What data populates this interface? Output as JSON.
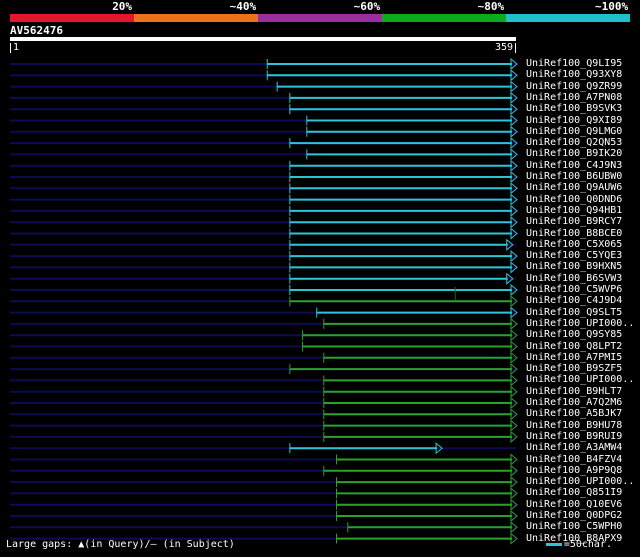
{
  "header": {
    "percent_labels": [
      "20%",
      "~40%",
      "~60%",
      "~80%",
      "~100%"
    ],
    "percent_colors": [
      "#e8132d",
      "#e8731c",
      "#9b2e9c",
      "#0eaa1a",
      "#1fc0c6"
    ]
  },
  "query": {
    "name": "AV562476",
    "start": "1",
    "end": "359"
  },
  "colors": {
    "backbone": "#0c0c55",
    "cyan": "#2bc6d6",
    "green": "#2aa12a",
    "marker": "#0a6a0a"
  },
  "hits": [
    {
      "name": "UniRef100_Q9LI95",
      "start": 183,
      "end": 359,
      "color": "cyan"
    },
    {
      "name": "UniRef100_Q93XY8",
      "start": 183,
      "end": 359,
      "color": "cyan"
    },
    {
      "name": "UniRef100_Q9ZR99",
      "start": 190,
      "end": 359,
      "color": "cyan"
    },
    {
      "name": "UniRef100_A7PN08",
      "start": 199,
      "end": 359,
      "color": "cyan"
    },
    {
      "name": "UniRef100_B9SVK3",
      "start": 199,
      "end": 359,
      "color": "cyan"
    },
    {
      "name": "UniRef100_Q9XI89",
      "start": 211,
      "end": 359,
      "color": "cyan"
    },
    {
      "name": "UniRef100_Q9LMG0",
      "start": 211,
      "end": 359,
      "color": "cyan"
    },
    {
      "name": "UniRef100_Q2QN53",
      "start": 199,
      "end": 359,
      "color": "cyan"
    },
    {
      "name": "UniRef100_B9IK20",
      "start": 211,
      "end": 359,
      "color": "cyan"
    },
    {
      "name": "UniRef100_C4J9N3",
      "start": 199,
      "end": 359,
      "color": "cyan"
    },
    {
      "name": "UniRef100_B6UBW0",
      "start": 199,
      "end": 359,
      "color": "cyan"
    },
    {
      "name": "UniRef100_Q9AUW6",
      "start": 199,
      "end": 359,
      "color": "cyan"
    },
    {
      "name": "UniRef100_Q0DND6",
      "start": 199,
      "end": 359,
      "color": "cyan"
    },
    {
      "name": "UniRef100_Q94HB1",
      "start": 199,
      "end": 359,
      "color": "cyan"
    },
    {
      "name": "UniRef100_B9RCY7",
      "start": 199,
      "end": 359,
      "color": "cyan"
    },
    {
      "name": "UniRef100_B8BCE0",
      "start": 199,
      "end": 359,
      "color": "cyan"
    },
    {
      "name": "UniRef100_C5X065",
      "start": 199,
      "end": 356,
      "color": "cyan"
    },
    {
      "name": "UniRef100_C5YQE3",
      "start": 199,
      "end": 359,
      "color": "cyan"
    },
    {
      "name": "UniRef100_B9HXN5",
      "start": 199,
      "end": 359,
      "color": "cyan"
    },
    {
      "name": "UniRef100_B6SVW3",
      "start": 199,
      "end": 356,
      "color": "cyan"
    },
    {
      "name": "UniRef100_C5WVP6",
      "start": 199,
      "end": 359,
      "color": "cyan",
      "marker": 316
    },
    {
      "name": "UniRef100_C4J9D4",
      "start": 199,
      "end": 359,
      "color": "green"
    },
    {
      "name": "UniRef100_Q9SLT5",
      "start": 218,
      "end": 359,
      "color": "cyan"
    },
    {
      "name": "UniRef100_UPI000..",
      "start": 223,
      "end": 359,
      "color": "green"
    },
    {
      "name": "UniRef100_Q9SY85",
      "start": 208,
      "end": 359,
      "color": "green"
    },
    {
      "name": "UniRef100_Q8LPT2",
      "start": 208,
      "end": 359,
      "color": "green"
    },
    {
      "name": "UniRef100_A7PMI5",
      "start": 223,
      "end": 359,
      "color": "green"
    },
    {
      "name": "UniRef100_B9SZF5",
      "start": 199,
      "end": 359,
      "color": "green"
    },
    {
      "name": "UniRef100_UPI000..",
      "start": 223,
      "end": 359,
      "color": "green"
    },
    {
      "name": "UniRef100_B9HLT7",
      "start": 223,
      "end": 359,
      "color": "green"
    },
    {
      "name": "UniRef100_A7Q2M6",
      "start": 223,
      "end": 359,
      "color": "green"
    },
    {
      "name": "UniRef100_A5BJK7",
      "start": 223,
      "end": 359,
      "color": "green"
    },
    {
      "name": "UniRef100_B9HU78",
      "start": 223,
      "end": 359,
      "color": "green"
    },
    {
      "name": "UniRef100_B9RUI9",
      "start": 223,
      "end": 359,
      "color": "green"
    },
    {
      "name": "UniRef100_A3AMW4",
      "start": 199,
      "end": 306,
      "color": "cyan"
    },
    {
      "name": "UniRef100_B4FZV4",
      "start": 232,
      "end": 359,
      "color": "green"
    },
    {
      "name": "UniRef100_A9P9Q8",
      "start": 223,
      "end": 359,
      "color": "green"
    },
    {
      "name": "UniRef100_UPI000..",
      "start": 232,
      "end": 359,
      "color": "green"
    },
    {
      "name": "UniRef100_Q851I9",
      "start": 232,
      "end": 359,
      "color": "green"
    },
    {
      "name": "UniRef100_Q10EV6",
      "start": 232,
      "end": 359,
      "color": "green"
    },
    {
      "name": "UniRef100_Q0DPG2",
      "start": 232,
      "end": 359,
      "color": "green"
    },
    {
      "name": "UniRef100_C5WPH0",
      "start": 240,
      "end": 359,
      "color": "green"
    },
    {
      "name": "UniRef100_B8APX9",
      "start": 232,
      "end": 359,
      "color": "green"
    }
  ],
  "footer": {
    "gaps_prefix": "Large gaps:",
    "gaps_query_icon": "▲",
    "gaps_query_text": "(in Query)/",
    "gaps_subject_icon": "–",
    "gaps_subject_text": " (in Subject)",
    "scale_text": "=50char."
  }
}
